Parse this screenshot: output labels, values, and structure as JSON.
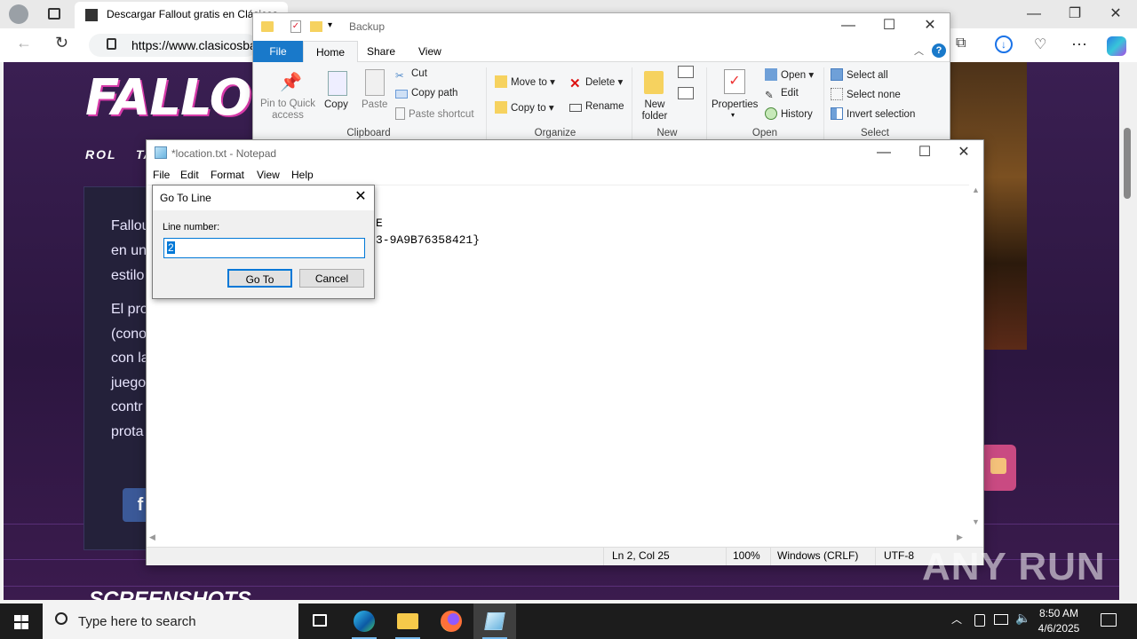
{
  "browser": {
    "tab_title": "Descargar Fallout gratis en Clásicos...",
    "url": "https://www.clasicosba...",
    "site": {
      "logo": "FALLOUT",
      "nav": [
        "ROL",
        "TÁ"
      ],
      "paragraph1": [
        "Fallou",
        "en un",
        "estilo"
      ],
      "paragraph2": [
        "El pro",
        "(cono",
        "con la",
        "juego",
        "contr",
        "prota"
      ],
      "fb_label": "f",
      "section_heading": "SCREENSHOTS"
    }
  },
  "explorer": {
    "title": "Backup",
    "tabs": [
      "File",
      "Home",
      "Share",
      "View"
    ],
    "clipboard": {
      "group": "Clipboard",
      "pin": "Pin to Quick access",
      "copy": "Copy",
      "paste": "Paste",
      "cut": "Cut",
      "copy_path": "Copy path",
      "paste_shortcut": "Paste shortcut"
    },
    "organize": {
      "group": "Organize",
      "move_to": "Move to",
      "copy_to": "Copy to",
      "delete": "Delete",
      "rename": "Rename"
    },
    "new": {
      "group": "New",
      "new_folder": "New folder"
    },
    "open": {
      "group": "Open",
      "properties": "Properties",
      "open": "Open",
      "edit": "Edit",
      "history": "History"
    },
    "select": {
      "group": "Select",
      "select_all": "Select all",
      "select_none": "Select none",
      "invert": "Invert selection"
    }
  },
  "notepad": {
    "title": "*location.txt - Notepad",
    "menu": [
      "File",
      "Edit",
      "Format",
      "View",
      "Help"
    ],
    "lines": [
      "E",
      "3-9A9B76358421}"
    ],
    "status": {
      "position": "Ln 2, Col 25",
      "zoom": "100%",
      "eol": "Windows (CRLF)",
      "encoding": "UTF-8"
    }
  },
  "goto_dialog": {
    "title": "Go To Line",
    "label": "Line number:",
    "value": "2",
    "ok": "Go To",
    "cancel": "Cancel"
  },
  "taskbar": {
    "search_placeholder": "Type here to search",
    "time": "8:50 AM",
    "date": "4/6/2025"
  },
  "watermark": "ANY RUN",
  "colors": {
    "accent": "#0078d7",
    "file_tab": "#1979ca",
    "taskbar": "#1c1c1c"
  }
}
